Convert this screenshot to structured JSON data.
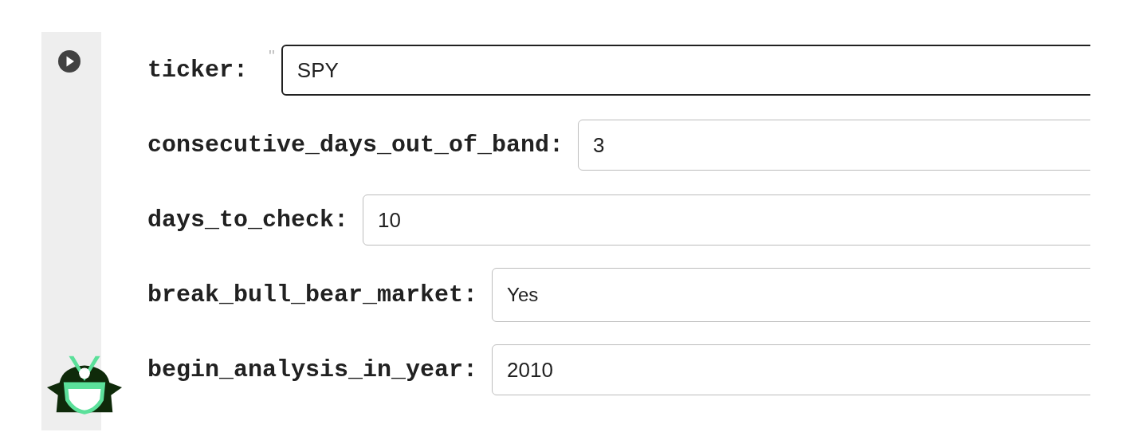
{
  "fields": [
    {
      "label": "ticker:",
      "kind": "text",
      "value": "SPY",
      "focused": true,
      "mark": "\""
    },
    {
      "label": "consecutive_days_out_of_band:",
      "kind": "text",
      "value": "3",
      "focused": false
    },
    {
      "label": "days_to_check:",
      "kind": "text",
      "value": "10",
      "focused": false
    },
    {
      "label": "break_bull_bear_market:",
      "kind": "select",
      "value": "Yes",
      "focused": false
    },
    {
      "label": "begin_analysis_in_year:",
      "kind": "text",
      "value": "2010",
      "focused": false
    }
  ]
}
